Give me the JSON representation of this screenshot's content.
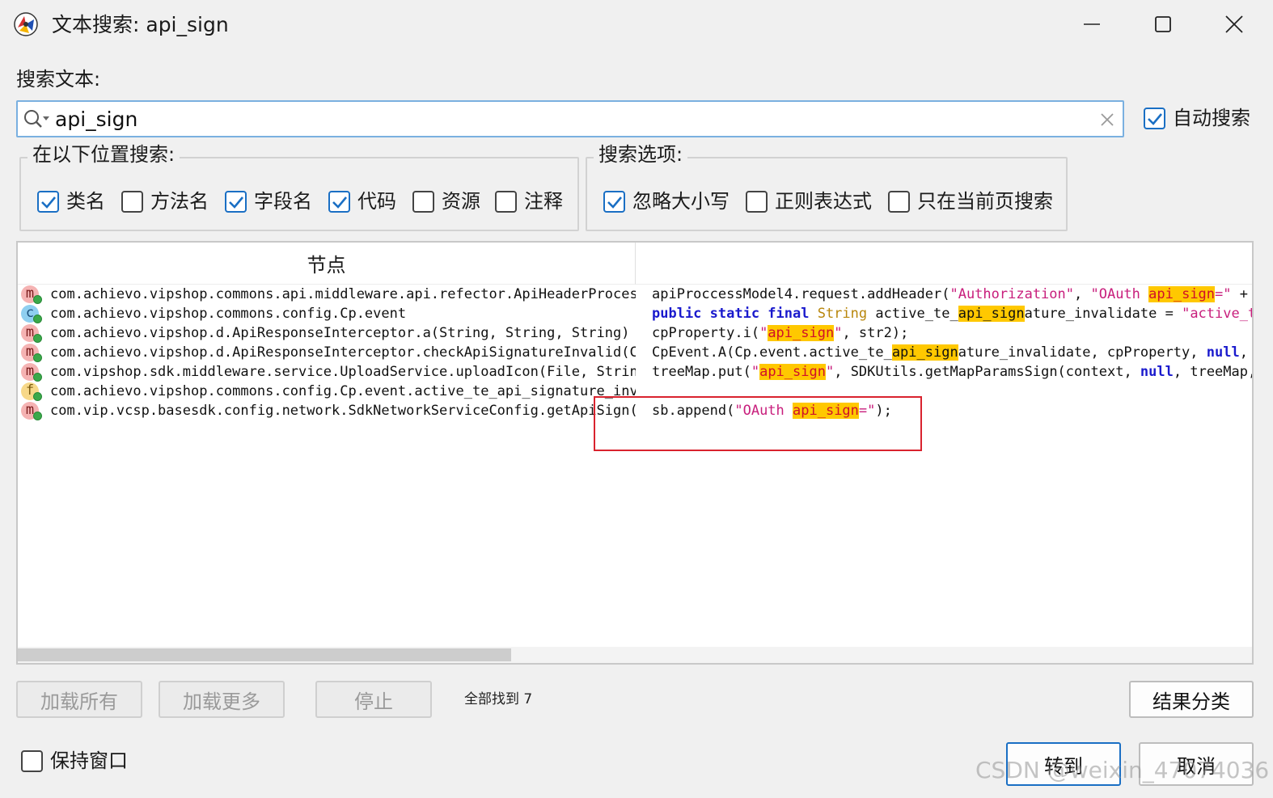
{
  "window": {
    "title": "文本搜索: api_sign",
    "app_icon": "jadx-logo-icon",
    "controls": [
      "minimize-icon",
      "maximize-icon",
      "close-icon"
    ]
  },
  "search": {
    "label": "搜索文本:",
    "value": "api_sign",
    "auto_search_label": "自动搜索",
    "auto_search_checked": true
  },
  "search_in": {
    "title": "在以下位置搜索:",
    "options": [
      {
        "label": "类名",
        "checked": true
      },
      {
        "label": "方法名",
        "checked": false
      },
      {
        "label": "字段名",
        "checked": true
      },
      {
        "label": "代码",
        "checked": true
      },
      {
        "label": "资源",
        "checked": false
      },
      {
        "label": "注释",
        "checked": false
      }
    ]
  },
  "search_options": {
    "title": "搜索选项:",
    "options": [
      {
        "label": "忽略大小写",
        "checked": true
      },
      {
        "label": "正则表达式",
        "checked": false
      },
      {
        "label": "只在当前页搜索",
        "checked": false
      }
    ]
  },
  "results": {
    "column_node": "节点",
    "column_code": "",
    "rows": [
      {
        "icon": "method-icon",
        "letter": "m",
        "node": "com.achievo.vipshop.commons.api.middleware.api.refector.ApiHeaderProcessc",
        "code": [
          [
            "t",
            "apiProccessModel4.request.addHeader("
          ],
          [
            "s",
            "\"Authorization\""
          ],
          [
            "t",
            ", "
          ],
          [
            "s",
            "\"OAuth "
          ],
          [
            "h",
            "api_sign"
          ],
          [
            "s",
            "=\""
          ],
          [
            "t",
            " + st"
          ]
        ]
      },
      {
        "icon": "class-icon",
        "letter": "c",
        "node": "com.achievo.vipshop.commons.config.Cp.event",
        "code": [
          [
            "k",
            "public static final "
          ],
          [
            "y",
            "String"
          ],
          [
            "t",
            " active_te_"
          ],
          [
            "g",
            "api_sign"
          ],
          [
            "t",
            "ature_invalidate = "
          ],
          [
            "s",
            "\"active_te_"
          ]
        ]
      },
      {
        "icon": "method-icon",
        "letter": "m",
        "node": "com.achievo.vipshop.d.ApiResponseInterceptor.a(String, String, String) vc",
        "code": [
          [
            "t",
            "cpProperty.i("
          ],
          [
            "s",
            "\""
          ],
          [
            "h",
            "api_sign"
          ],
          [
            "s",
            "\""
          ],
          [
            "t",
            ", str2);"
          ]
        ]
      },
      {
        "icon": "method-icon",
        "letter": "m",
        "node": "com.achievo.vipshop.d.ApiResponseInterceptor.checkApiSignatureInvalid(Cor",
        "code": [
          [
            "t",
            "CpEvent.A(Cp.event.active_te_"
          ],
          [
            "g",
            "api_sign"
          ],
          [
            "t",
            "ature_invalidate, cpProperty, "
          ],
          [
            "k",
            "null"
          ],
          [
            "t",
            ", nu"
          ]
        ]
      },
      {
        "icon": "method-icon",
        "letter": "m",
        "node": "com.vipshop.sdk.middleware.service.UploadService.uploadIcon(File, String)",
        "code": [
          [
            "t",
            "treeMap.put("
          ],
          [
            "s",
            "\""
          ],
          [
            "h",
            "api_sign"
          ],
          [
            "s",
            "\""
          ],
          [
            "t",
            ", SDKUtils.getMapParamsSign(context, "
          ],
          [
            "k",
            "null"
          ],
          [
            "t",
            ", treeMap, A"
          ]
        ]
      },
      {
        "icon": "field-icon",
        "letter": "f",
        "node": "com.achievo.vipshop.commons.config.Cp.event.active_te_api_signature_inval",
        "code": []
      },
      {
        "icon": "method-icon",
        "letter": "m",
        "node": "com.vip.vcsp.basesdk.config.network.SdkNetworkServiceConfig.getApiSign(VC",
        "code": [
          [
            "t",
            "sb.append("
          ],
          [
            "s",
            "\"OAuth "
          ],
          [
            "h",
            "api_sign"
          ],
          [
            "s",
            "=\""
          ],
          [
            "t",
            ");"
          ]
        ]
      }
    ]
  },
  "footer": {
    "load_all": "加载所有",
    "load_more": "加载更多",
    "stop": "停止",
    "found": "全部找到 7",
    "classify": "结果分类",
    "keep_window_label": "保持窗口",
    "keep_window_checked": false,
    "goto": "转到",
    "cancel": "取消"
  },
  "watermark": "CSDN @weixin_47074036",
  "colors": {
    "string": "#c81e7c",
    "keyword": "#1a1acd",
    "type": "#b8860b",
    "highlight": "#ffc800",
    "annotation_box": "#d9232e",
    "focus_border": "#1a6fc4"
  }
}
